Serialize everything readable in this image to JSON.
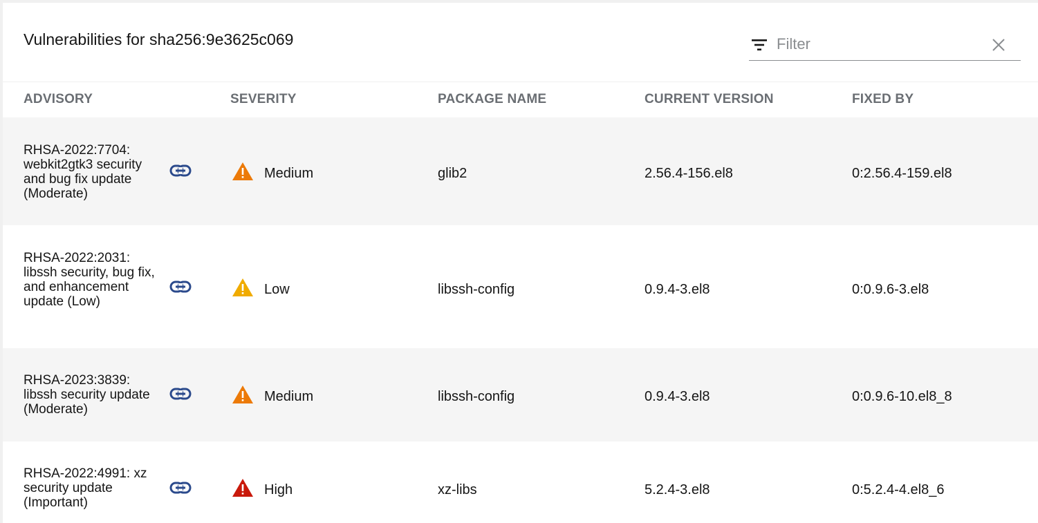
{
  "header": {
    "title": "Vulnerabilities for sha256:9e3625c069"
  },
  "filter": {
    "placeholder": "Filter",
    "value": "",
    "filter_icon": "filter-icon",
    "clear_icon": "close-icon"
  },
  "table": {
    "columns": [
      "ADVISORY",
      "SEVERITY",
      "PACKAGE NAME",
      "CURRENT VERSION",
      "FIXED BY"
    ],
    "rows": [
      {
        "advisory": "RHSA-2022:7704: webkit2gtk3 security and bug fix update (Moderate)",
        "severity": "Medium",
        "package_name": "glib2",
        "current_version": "2.56.4-156.el8",
        "fixed_by": "0:2.56.4-159.el8"
      },
      {
        "advisory": "RHSA-2022:2031: libssh security, bug fix, and enhancement update (Low)",
        "severity": "Low",
        "package_name": "libssh-config",
        "current_version": "0.9.4-3.el8",
        "fixed_by": "0:0.9.6-3.el8"
      },
      {
        "advisory": "RHSA-2023:3839: libssh security update (Moderate)",
        "severity": "Medium",
        "package_name": "libssh-config",
        "current_version": "0.9.4-3.el8",
        "fixed_by": "0:0.9.6-10.el8_8"
      },
      {
        "advisory": "RHSA-2022:4991: xz security update (Important)",
        "severity": "High",
        "package_name": "xz-libs",
        "current_version": "5.2.4-3.el8",
        "fixed_by": "0:5.2.4-4.el8_6"
      }
    ]
  },
  "colors": {
    "severity_high": "#c9190b",
    "severity_medium": "#ec7a08",
    "severity_low": "#f0ab00",
    "link": "#2b4a8c",
    "header_text": "#6a6e73",
    "row_shade": "#f5f5f5"
  },
  "icons": {
    "link": "link-icon",
    "severity": "warning-triangle-icon"
  }
}
